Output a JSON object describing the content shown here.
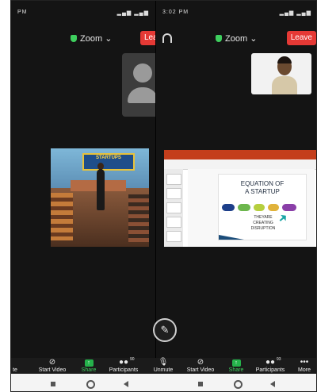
{
  "left_panel": {
    "status_time": "PM",
    "zoom_label": "Zoom",
    "leave_label": "Leav",
    "gallery_banner": "STARTUPS"
  },
  "right_panel": {
    "status_time": "3:02 PM",
    "zoom_label": "Zoom",
    "leave_label": "Leave",
    "slide": {
      "title_line1": "EQUATION OF",
      "title_line2": "A STARTUP",
      "text_line1": "THEYARE",
      "text_line2": "CREATING",
      "text_line3": "DISRUPTION"
    }
  },
  "toolbar": {
    "left": {
      "mute_label": "te",
      "start_video_label": "Start Video",
      "share_label": "Share",
      "participants_label": "Participants",
      "participants_count": "90"
    },
    "right": {
      "unmute_label": "Unmute",
      "start_video_label": "Start Video",
      "share_label": "Share",
      "participants_label": "Participants",
      "participants_count": "93",
      "more_label": "More"
    }
  },
  "colors": {
    "accent_green": "#3ecf5e",
    "leave_red": "#e53935",
    "dark_bg": "#141414"
  },
  "icons": [
    "shield-icon",
    "chevron-down-icon",
    "headset-icon",
    "pen-icon",
    "video-off-icon",
    "share-icon",
    "participants-icon",
    "mic-off-icon",
    "more-icon"
  ]
}
